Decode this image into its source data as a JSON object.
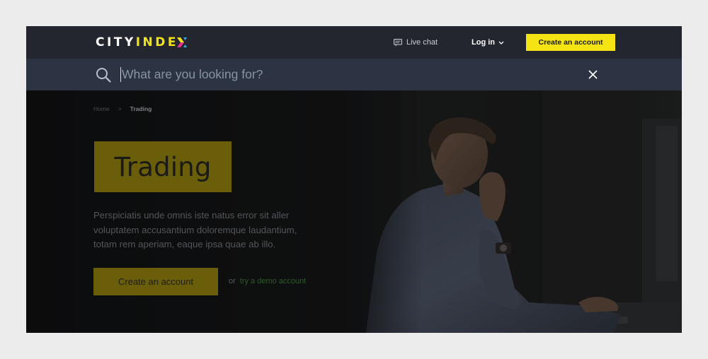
{
  "brand": {
    "logo_part1": "CITY",
    "logo_part2": "INDE",
    "colors": {
      "accent": "#f5e414",
      "nav_bg": "#23262e",
      "search_bg": "#2c3444"
    }
  },
  "topnav": {
    "live_chat_label": "Live chat",
    "login_label": "Log in",
    "create_account_label": "Create an account"
  },
  "search": {
    "placeholder": "What are you looking for?",
    "value": ""
  },
  "breadcrumb": {
    "home": "Home",
    "separator": ">",
    "current": "Trading"
  },
  "hero": {
    "title": "Trading",
    "description": "Perspiciatis unde omnis iste natus error sit aller voluptatem accusantium doloremque laudantium, totam rem aperiam, eaque ipsa quae ab illo.",
    "cta_label": "Create an account",
    "or_label": "or",
    "demo_link_label": "try a demo account"
  },
  "icons": {
    "chat": "chat-bubble-icon",
    "chevron": "chevron-down-icon",
    "search": "search-icon",
    "close": "close-icon"
  }
}
